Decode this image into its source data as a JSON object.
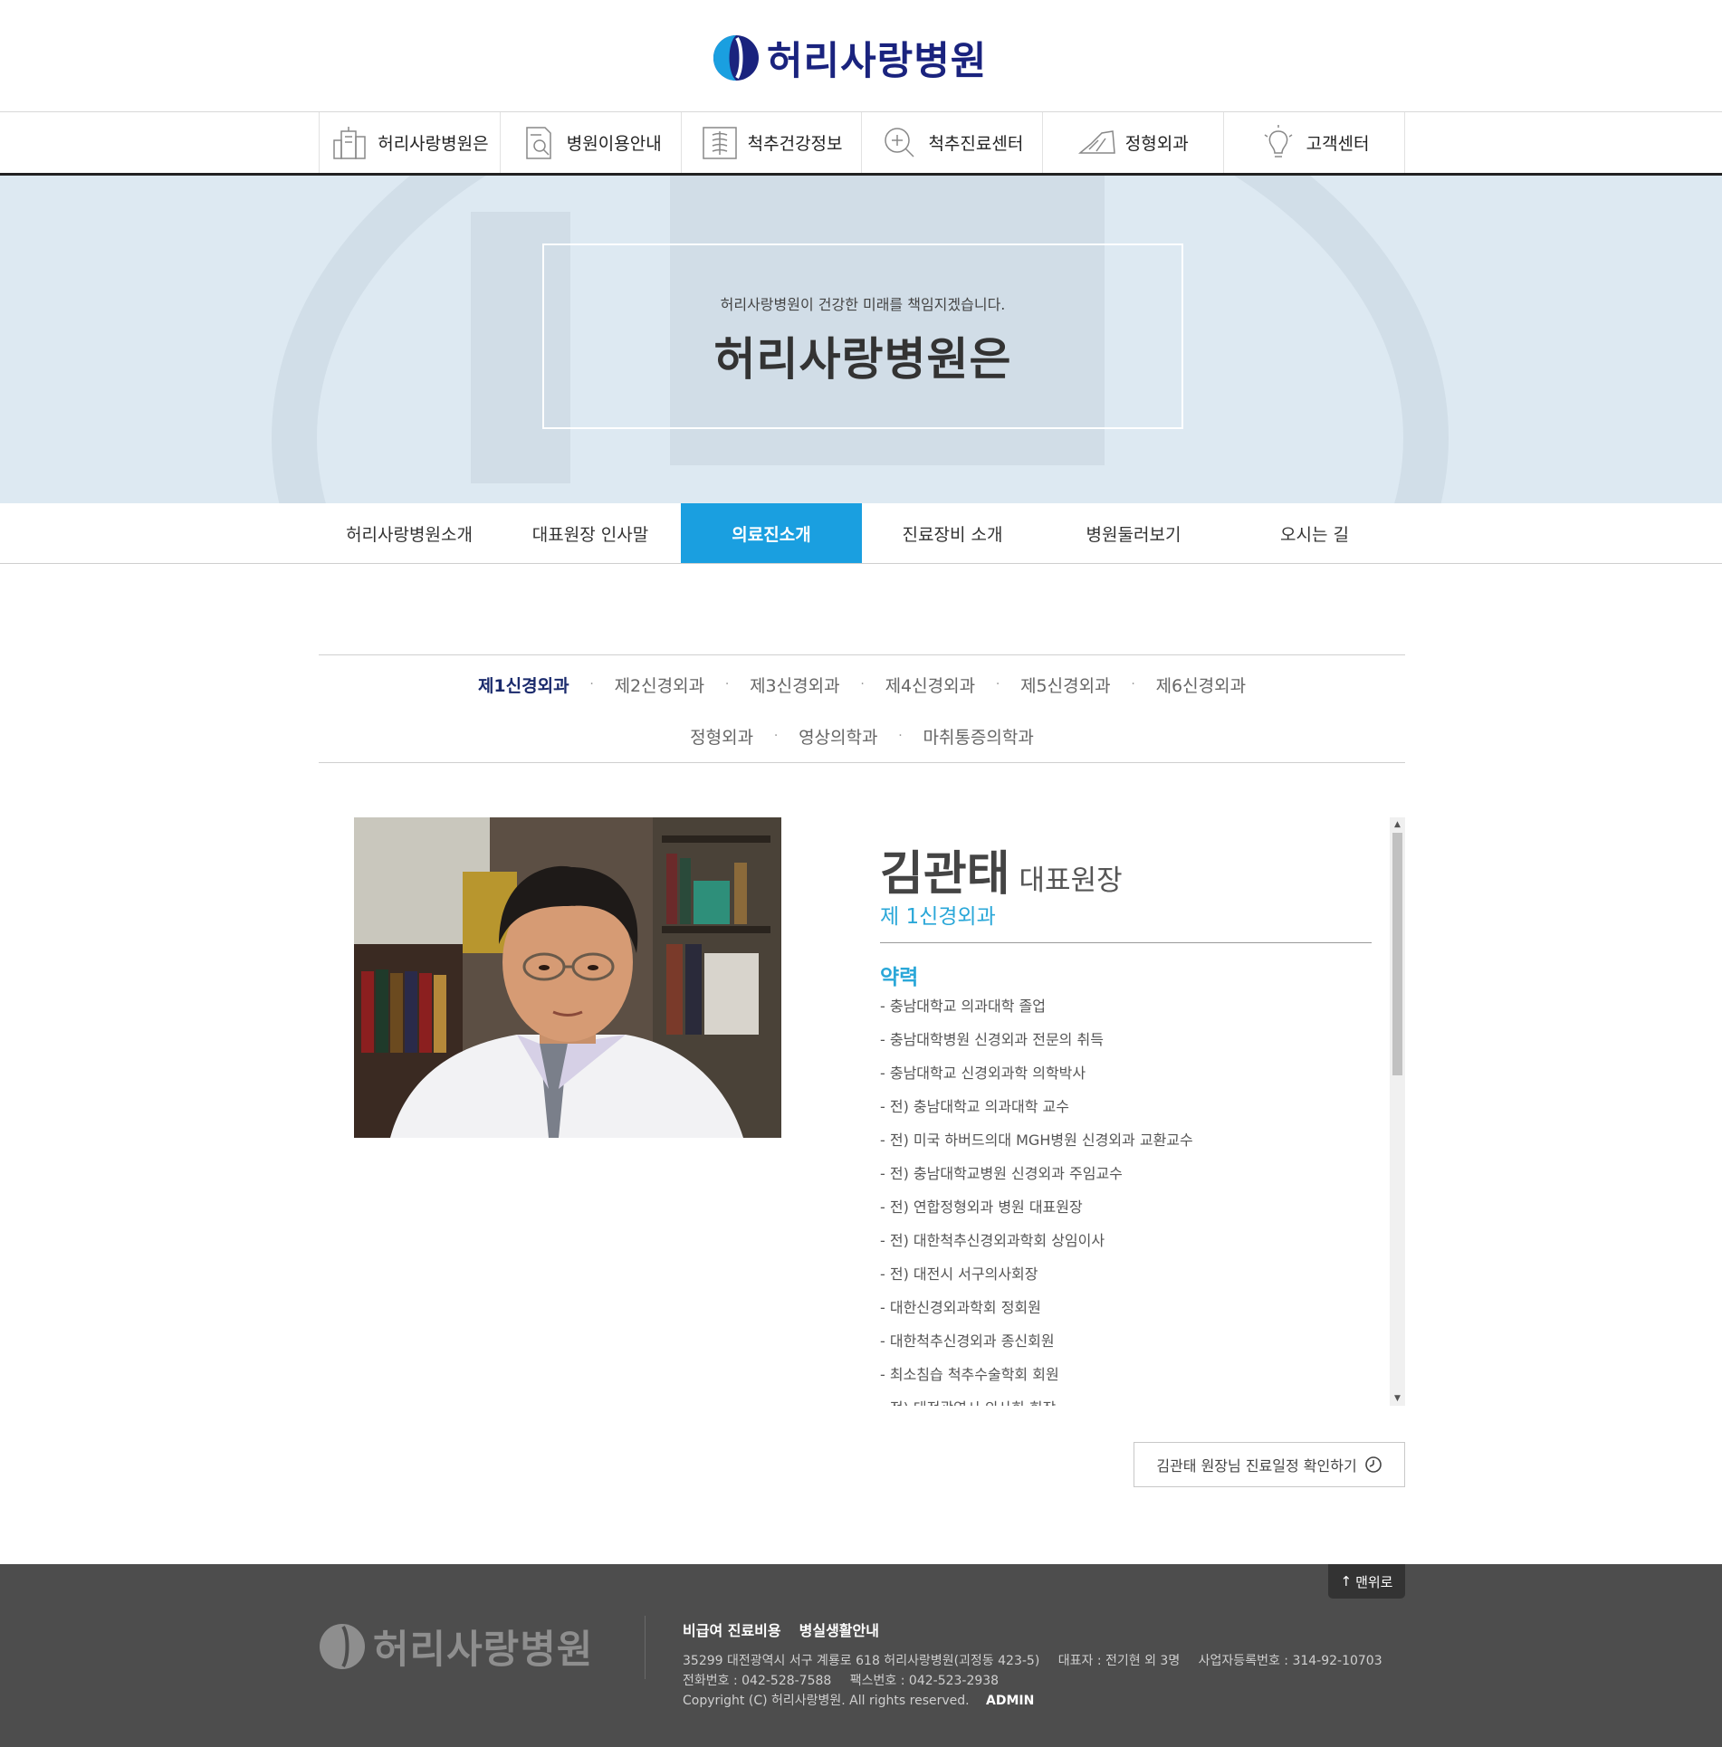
{
  "header": {
    "logo_text": "허리사랑병원"
  },
  "gnb": {
    "items": [
      {
        "label": "허리사랑병원은",
        "icon": "building-icon"
      },
      {
        "label": "병원이용안내",
        "icon": "document-search-icon"
      },
      {
        "label": "척추건강정보",
        "icon": "spine-icon"
      },
      {
        "label": "척추진료센터",
        "icon": "zoom-plus-icon"
      },
      {
        "label": "정형외과",
        "icon": "foot-icon"
      },
      {
        "label": "고객센터",
        "icon": "lightbulb-icon"
      }
    ]
  },
  "visual": {
    "subtitle": "허리사랑병원이 건강한 미래를 책임지겠습니다.",
    "title": "허리사랑병원은"
  },
  "subnav": {
    "items": [
      "허리사랑병원소개",
      "대표원장 인사말",
      "의료진소개",
      "진료장비 소개",
      "병원둘러보기",
      "오시는 길"
    ],
    "active": "의료진소개"
  },
  "departments": {
    "row1": [
      "제1신경외과",
      "제2신경외과",
      "제3신경외과",
      "제4신경외과",
      "제5신경외과",
      "제6신경외과"
    ],
    "row2": [
      "정형외과",
      "영상의학과",
      "마취통증의학과"
    ],
    "separator": "·",
    "active": "제1신경외과"
  },
  "doctor": {
    "name": "김관태",
    "title": "대표원장",
    "department": "제 1신경외과",
    "career_title": "약력",
    "career": [
      "- 충남대학교 의과대학 졸업",
      "- 충남대학병원 신경외과 전문의 취득",
      "- 충남대학교 신경외과학 의학박사",
      "- 전) 충남대학교 의과대학 교수",
      "- 전) 미국 하버드의대 MGH병원 신경외과 교환교수",
      "- 전) 충남대학교병원 신경외과 주임교수",
      "- 전) 연합정형외과 병원 대표원장",
      "- 전) 대한척추신경외과학회 상임이사",
      "- 전) 대전시 서구의사회장",
      "- 대한신경외과학회 정회원",
      "- 대한척추신경외과 종신회원",
      "- 최소침습 척추수술학회 회원",
      "- 전) 대전광역시 의사회 회장"
    ],
    "schedule_button": "김관태 원장님 진료일정 확인하기"
  },
  "footer": {
    "top_button": "맨위로",
    "logo_text": "허리사랑병원",
    "links": [
      "비급여 진료비용",
      "병실생활안내"
    ],
    "address": "35299 대전광역시 서구 계룡로 618 허리사랑병원(괴정동 423-5)",
    "ceo": "대표자 : 전기현 외 3명",
    "biz_no": "사업자등록번호 : 314-92-10703",
    "tel": "전화번호 : 042-528-7588",
    "fax": "팩스번호 : 042-523-2938",
    "copyright": "Copyright (C) 허리사랑병원. All rights reserved.",
    "admin": "ADMIN"
  },
  "colors": {
    "brand_navy": "#1a237e",
    "accent_blue": "#1a9fe0",
    "footer_bg": "#4d4d4d"
  }
}
